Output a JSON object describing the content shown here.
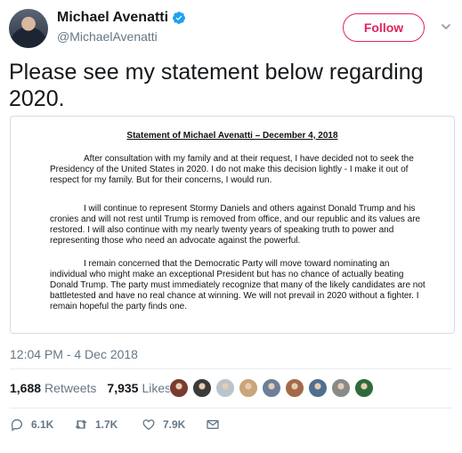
{
  "author": {
    "display_name": "Michael Avenatti",
    "handle": "@MichaelAvenatti",
    "verified": true
  },
  "follow_label": "Follow",
  "tweet_text": "Please see my statement below regarding 2020.",
  "document": {
    "title": "Statement of Michael Avenatti – December 4, 2018",
    "paragraphs": [
      "After consultation with my family and at their request, I have decided not to seek the Presidency of the United States in 2020. I do not make this decision lightly - I make it out of respect for my family. But for their concerns, I would run.",
      "I will continue to represent Stormy Daniels and others against Donald Trump and his cronies and will not rest until Trump is removed from office, and our republic and its values are restored. I will also continue with my nearly twenty years of speaking truth to power and representing those who need an advocate against the powerful.",
      "I remain concerned that the Democratic Party will move toward nominating an individual who might make an exceptional President but has no chance of actually beating Donald Trump. The party must immediately recognize that many of the likely candidates are not battletested and have no real chance at winning. We will not prevail in 2020 without a fighter. I remain hopeful the party finds one."
    ]
  },
  "timestamp": "12:04 PM - 4 Dec 2018",
  "stats": {
    "retweets_count": "1,688",
    "retweets_label": "Retweets",
    "likes_count": "7,935",
    "likes_label": "Likes"
  },
  "liker_avatar_colors": [
    "#7a3b2e",
    "#3a3a3a",
    "#b9c4cc",
    "#c9a57a",
    "#6d7f9a",
    "#a36a4a",
    "#4f6f8f",
    "#8a8a8a",
    "#2f6b3a"
  ],
  "actions": {
    "reply_count": "6.1K",
    "retweet_count": "1.7K",
    "like_count": "7.9K"
  },
  "colors": {
    "follow_accent": "#e0245e",
    "verified_blue": "#1da1f2",
    "muted_text": "#657786"
  }
}
